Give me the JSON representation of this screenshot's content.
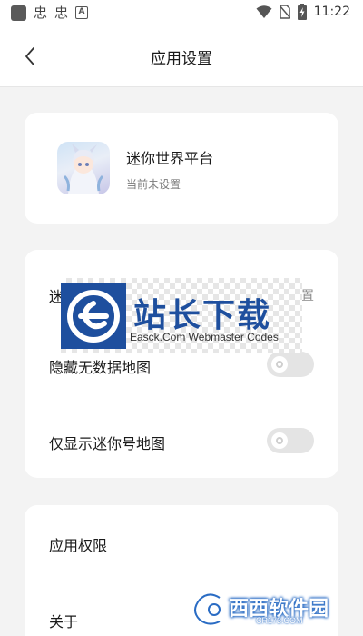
{
  "status_bar": {
    "notif_glyph_1": "忠",
    "notif_glyph_2": "忠",
    "notif_a": "A",
    "time": "11:22",
    "icons": [
      "wifi-icon",
      "no-sim-icon",
      "battery-charging-icon"
    ]
  },
  "header": {
    "title": "应用设置",
    "back_icon": "chevron-left-icon"
  },
  "app_card": {
    "name": "迷你世界平台",
    "status": "当前未设置"
  },
  "toggle_card": {
    "rows": [
      {
        "label": "迷你号",
        "right_text": "未设置"
      },
      {
        "label": "隐藏无数据地图",
        "enabled": false
      },
      {
        "label": "仅显示迷你号地图",
        "enabled": false
      }
    ]
  },
  "links_card": {
    "items": [
      {
        "label": "应用权限"
      },
      {
        "label": "关于"
      }
    ]
  },
  "watermark": {
    "title": "站长下载",
    "subtitle": "Easck.Com Webmaster Codes"
  },
  "corner_watermark": {
    "title": "西西软件园",
    "subtitle": "CR173.COM"
  },
  "colors": {
    "background": "#f3f3f3",
    "card": "#ffffff",
    "toggle_off": "#e4e4e4",
    "watermark_blue": "#1e4f9e"
  }
}
